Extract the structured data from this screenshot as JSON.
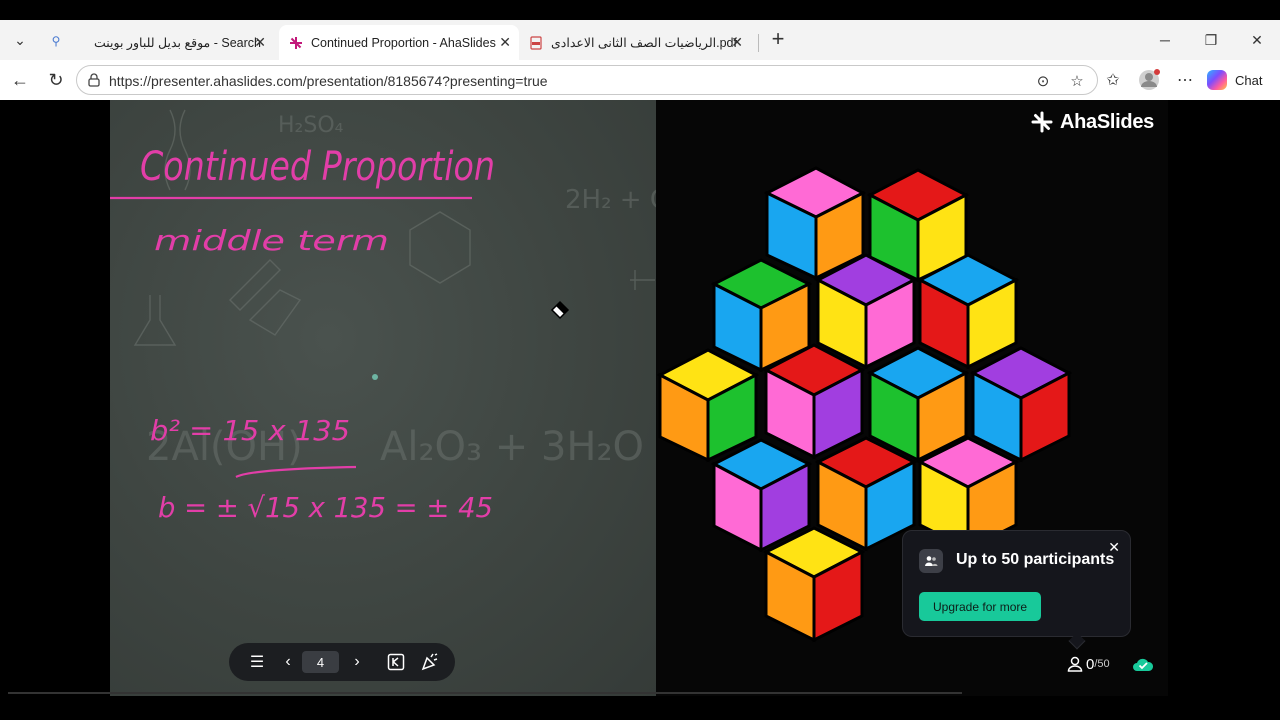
{
  "browser": {
    "tabs": [
      {
        "label": "موقع بديل للباور بوينت - Search",
        "active": false
      },
      {
        "label": "Continued Proportion - AhaSlides",
        "active": true
      },
      {
        "label": "الرياضيات الصف الثانى الاعدادى.pdf",
        "active": false
      }
    ],
    "url": "https://presenter.ahaslides.com/presentation/8185674?presenting=true",
    "chat_label": "Chat"
  },
  "slide": {
    "board_text": {
      "title": "Continued Proportion",
      "subtitle": "middle term",
      "eq1": "b² = 15 x 135",
      "eq2": "b = ± √15 x 135 = ± 45"
    },
    "brand": "AhaSlides",
    "colors": {
      "ink": "#e23ea8",
      "accent": "#18c99a"
    }
  },
  "popup": {
    "title": "Up to 50 participants",
    "button": "Upgrade for more"
  },
  "participants": {
    "count": "0",
    "max": "/50"
  },
  "controls": {
    "page": "4"
  }
}
